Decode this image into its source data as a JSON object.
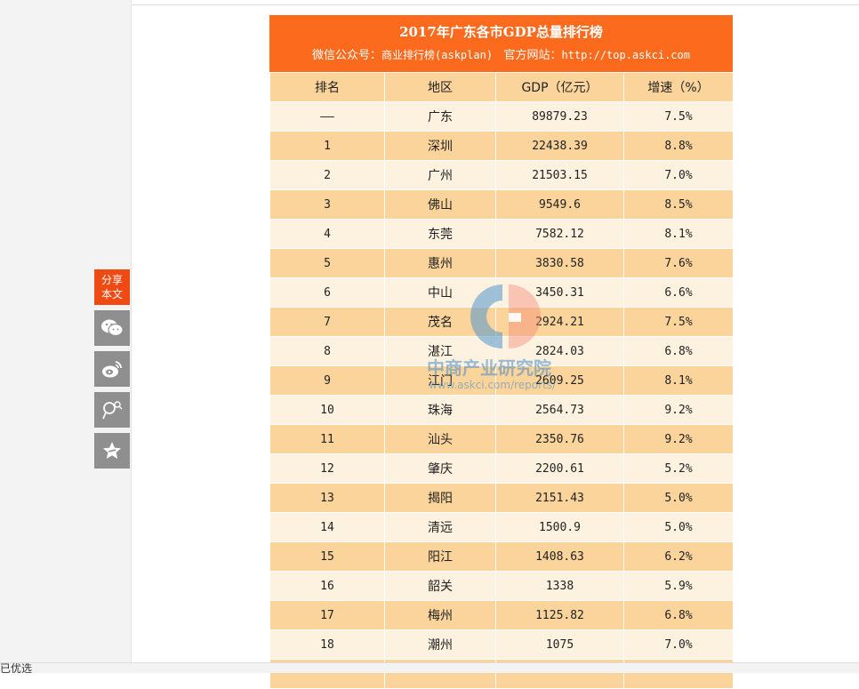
{
  "title": "2017年广东各市GDP总量排行榜",
  "subtitle": {
    "wechat_label": "微信公众号：",
    "wechat_value": "商业排行榜(askplan)",
    "site_label": "官方网站：",
    "site_value": "http://top.askci.com"
  },
  "columns": [
    "排名",
    "地区",
    "GDP（亿元）",
    "增速（%）"
  ],
  "rows": [
    [
      "——",
      "广东",
      "89879.23",
      "7.5%"
    ],
    [
      "1",
      "深圳",
      "22438.39",
      "8.8%"
    ],
    [
      "2",
      "广州",
      "21503.15",
      "7.0%"
    ],
    [
      "3",
      "佛山",
      "9549.6",
      "8.5%"
    ],
    [
      "4",
      "东莞",
      "7582.12",
      "8.1%"
    ],
    [
      "5",
      "惠州",
      "3830.58",
      "7.6%"
    ],
    [
      "6",
      "中山",
      "3450.31",
      "6.6%"
    ],
    [
      "7",
      "茂名",
      "2924.21",
      "7.5%"
    ],
    [
      "8",
      "湛江",
      "2824.03",
      "6.8%"
    ],
    [
      "9",
      "江门",
      "2609.25",
      "8.1%"
    ],
    [
      "10",
      "珠海",
      "2564.73",
      "9.2%"
    ],
    [
      "11",
      "汕头",
      "2350.76",
      "9.2%"
    ],
    [
      "12",
      "肇庆",
      "2200.61",
      "5.2%"
    ],
    [
      "13",
      "揭阳",
      "2151.43",
      "5.0%"
    ],
    [
      "14",
      "清远",
      "1500.9",
      "5.0%"
    ],
    [
      "15",
      "阳江",
      "1408.63",
      "6.2%"
    ],
    [
      "16",
      "韶关",
      "1338",
      "5.9%"
    ],
    [
      "17",
      "梅州",
      "1125.82",
      "6.8%"
    ],
    [
      "18",
      "潮州",
      "1075",
      "7.0%"
    ],
    [
      "",
      "",
      "",
      ""
    ]
  ],
  "share": {
    "label_line1": "分享",
    "label_line2": "本文",
    "buttons": [
      "wechat-icon",
      "weibo-icon",
      "qzone-icon",
      "favorite-star-icon"
    ]
  },
  "watermark": {
    "name": "中商产业研究院",
    "url": "www.askci.com/reports/"
  },
  "footer_text": "已优选",
  "colors": {
    "header": "#fb6a1d",
    "row_dark": "#fad49a",
    "row_light": "#fdf2e0",
    "share_accent": "#f04a14",
    "share_button": "#8f8f8f"
  }
}
